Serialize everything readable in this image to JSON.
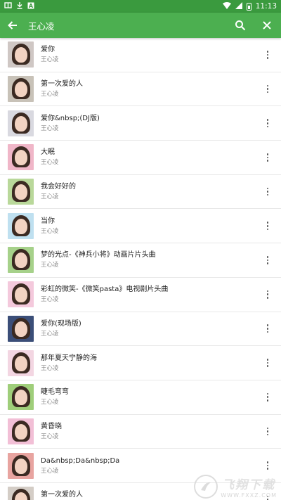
{
  "statusbar": {
    "left_icons": [
      "carrier-icon",
      "download-icon",
      "app-a-icon"
    ],
    "time": "11:13"
  },
  "toolbar": {
    "title": "王心凌"
  },
  "songs": [
    {
      "title": "爱你",
      "artist": "王心凌",
      "cover_bg": "#cfc7c4"
    },
    {
      "title": "第一次爱的人",
      "artist": "王心凌",
      "cover_bg": "#c8c2b8"
    },
    {
      "title": "爱你&nbsp;(DJ版)",
      "artist": "王心凌",
      "cover_bg": "#d9d9e0"
    },
    {
      "title": "大眠",
      "artist": "王心凌",
      "cover_bg": "#f0b6c8"
    },
    {
      "title": "我会好好的",
      "artist": "王心凌",
      "cover_bg": "#b9d89a"
    },
    {
      "title": "当你",
      "artist": "王心凌",
      "cover_bg": "#bfe0f0"
    },
    {
      "title": "梦的光点-《神兵小将》动画片片头曲",
      "artist": "王心凌",
      "cover_bg": "#a6d18a"
    },
    {
      "title": "彩虹的微笑-《微笑pasta》电视剧片头曲",
      "artist": "王心凌",
      "cover_bg": "#f4c9dc"
    },
    {
      "title": "爱你(现场版)",
      "artist": "王心凌",
      "cover_bg": "#3b4e78"
    },
    {
      "title": "那年夏天宁静的海",
      "artist": "王心凌",
      "cover_bg": "#f3d6e2"
    },
    {
      "title": "睫毛弯弯",
      "artist": "王心凌",
      "cover_bg": "#9fce7a"
    },
    {
      "title": "黄昏晓",
      "artist": "王心凌",
      "cover_bg": "#f2bfd6"
    },
    {
      "title": "Da&nbsp;Da&nbsp;Da",
      "artist": "王心凌",
      "cover_bg": "#e8a4a0"
    },
    {
      "title": "第一次爱的人",
      "artist": "王心凌",
      "cover_bg": "#d4cdc6"
    }
  ],
  "watermark": {
    "cn": "飞翔下载",
    "en": "WWW.FXXZ.COM"
  },
  "colors": {
    "statusbar": "#3a9a3e",
    "toolbar": "#4caf50"
  }
}
